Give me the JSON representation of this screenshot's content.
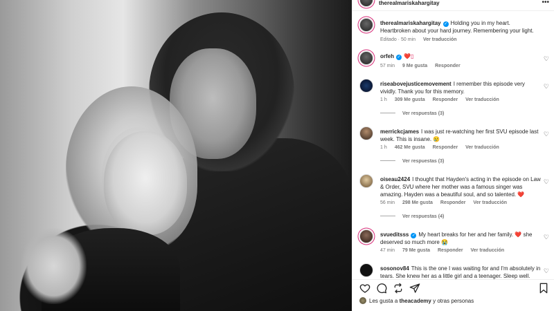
{
  "header": {
    "username": "therealmariskahargitay",
    "more_icon": "more-horizontal-icon"
  },
  "caption": {
    "username": "therealmariskahargitay",
    "text": "Holding you in my heart. Heartbroken about your hard journey. Remembering your light.",
    "time": "Editado · 50 min",
    "translate": "Ver traducción"
  },
  "comments": [
    {
      "username": "orfeh",
      "text": "❤️▯",
      "time": "57 min",
      "likes": "9 Me gusta",
      "reply": "Responder",
      "translate": "",
      "view_replies": ""
    },
    {
      "username": "riseabovejusticemovement",
      "text": "I remember this episode very vividly. Thank you for this memory.",
      "time": "1 h",
      "likes": "309 Me gusta",
      "reply": "Responder",
      "translate": "Ver traducción",
      "view_replies": "Ver respuestas (3)"
    },
    {
      "username": "merrickcjames",
      "text": "I was just re-watching her first SVU episode last week. This is insane. 😢",
      "time": "1 h",
      "likes": "462 Me gusta",
      "reply": "Responder",
      "translate": "Ver traducción",
      "view_replies": "Ver respuestas (3)"
    },
    {
      "username": "oiseau2424",
      "text": "I thought that Hayden's acting in the episode on Law & Order, SVU where her mother was a famous singer was amazing. Hayden was a beautiful soul, and so talented. ❤️",
      "time": "56 min",
      "likes": "298 Me gusta",
      "reply": "Responder",
      "translate": "Ver traducción",
      "view_replies": "Ver respuestas (4)"
    },
    {
      "username": "svueditsss",
      "text": "My heart breaks for her and her family. ❤️ she deserved so much more 😭",
      "time": "47 min",
      "likes": "79 Me gusta",
      "reply": "Responder",
      "translate": "Ver traducción",
      "view_replies": ""
    },
    {
      "username": "sosonov84",
      "text": "This is the one I was waiting for and I'm absolutely in tears. She knew her as a little girl and a teenager. Sleep well.",
      "time": "",
      "likes": "",
      "reply": "",
      "translate": "",
      "view_replies": ""
    }
  ],
  "actions": {
    "like_icon": "heart-outline-icon",
    "comment_icon": "comment-icon",
    "share_icon": "repost-icon",
    "send_icon": "send-icon",
    "save_icon": "bookmark-icon"
  },
  "likes_line": {
    "prefix": "Les gusta a",
    "user": "theacademy",
    "suffix": "y otras personas"
  },
  "colors": {
    "verified": "#0095f6",
    "heart": "#e0245e",
    "meta_text": "#737373"
  }
}
